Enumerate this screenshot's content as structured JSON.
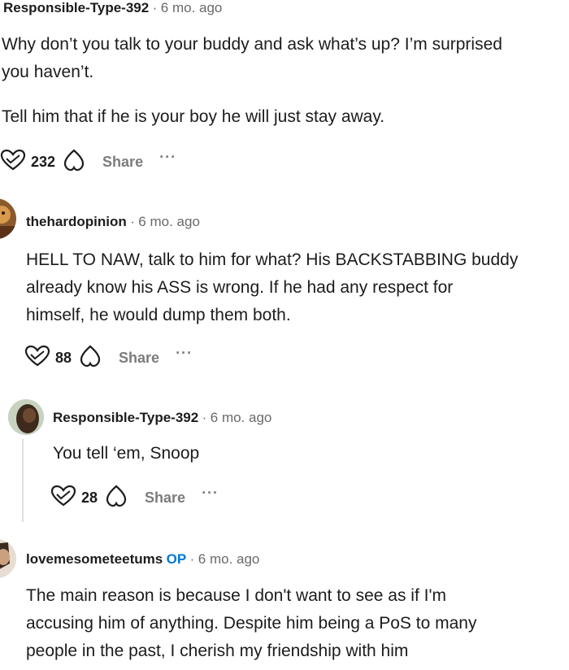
{
  "comments": [
    {
      "author": "Responsible-Type-392",
      "time": "6 mo. ago",
      "lines": [
        "Why don’t you talk to your buddy and ask what’s up? I’m surprised",
        "you haven’t.",
        "Tell him that if he is your boy he will just stay away."
      ],
      "votes": "232",
      "share": "Share",
      "more": "···"
    },
    {
      "author": "thehardopinion",
      "time": "6 mo. ago",
      "lines": [
        "HELL TO NAW, talk to him for what? His BACKSTABBING buddy",
        "already know his ASS is wrong. If he had any respect for",
        "himself, he would dump them both."
      ],
      "votes": "88",
      "share": "Share",
      "more": "···"
    },
    {
      "author": "Responsible-Type-392",
      "time": "6 mo. ago",
      "lines": [
        "You tell ‘em, Snoop"
      ],
      "votes": "28",
      "share": "Share",
      "more": "···"
    },
    {
      "author": "lovemesometeetums",
      "op": "OP",
      "time": "6 mo. ago",
      "lines": [
        "The main reason is because I don't want to see as if I'm",
        "accusing him of anything. Despite him being a PoS to many",
        "people in the past, I cherish my friendship with him"
      ]
    }
  ],
  "separator": "·",
  "icons": {
    "upvote": "upvote-heart-icon",
    "downvote": "downvote-heart-icon",
    "more": "more-options-icon"
  },
  "colors": {
    "op_badge": "#0079d3",
    "meta_gray": "#6a6a6a",
    "action_gray": "#7c7c7c"
  }
}
